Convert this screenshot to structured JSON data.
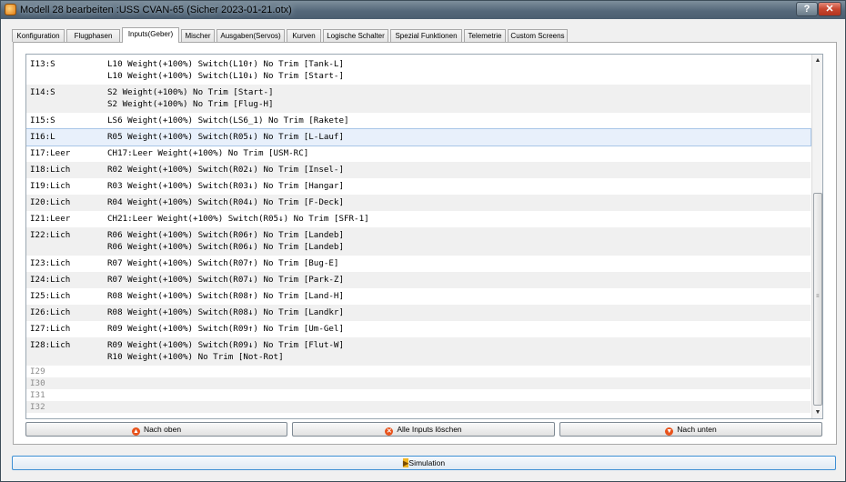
{
  "window": {
    "title": "Modell 28 bearbeiten :USS CVAN-65   (Sicher 2023-01-21.otx)",
    "help_label": "?",
    "close_label": "✕"
  },
  "tabs": [
    {
      "label": "Konfiguration"
    },
    {
      "label": "Flugphasen"
    },
    {
      "label": "Inputs(Geber)",
      "active": true
    },
    {
      "label": "Mischer"
    },
    {
      "label": "Ausgaben(Servos)"
    },
    {
      "label": "Kurven"
    },
    {
      "label": "Logische Schalter"
    },
    {
      "label": "Spezial Funktionen"
    },
    {
      "label": "Telemetrie"
    },
    {
      "label": "Custom Screens"
    }
  ],
  "inputs": [
    {
      "name": "I13:S",
      "lines": [
        "L10 Weight(+100%) Switch(L10↑) No Trim [Tank-L]",
        "L10 Weight(+100%) Switch(L10↓) No Trim [Start-]"
      ]
    },
    {
      "name": "I14:S",
      "lines": [
        "S2 Weight(+100%) No Trim [Start-]",
        "S2 Weight(+100%) No Trim [Flug-H]"
      ]
    },
    {
      "name": "I15:S",
      "lines": [
        "LS6 Weight(+100%) Switch(LS6_1) No Trim [Rakete]"
      ]
    },
    {
      "name": "I16:L",
      "lines": [
        "R05 Weight(+100%) Switch(R05↓) No Trim [L-Lauf]"
      ],
      "selected": true
    },
    {
      "name": "I17:Leer",
      "lines": [
        "CH17:Leer Weight(+100%) No Trim [USM-RC]"
      ]
    },
    {
      "name": "I18:Lich",
      "lines": [
        "R02 Weight(+100%) Switch(R02↓) No Trim [Insel-]"
      ]
    },
    {
      "name": "I19:Lich",
      "lines": [
        "R03 Weight(+100%) Switch(R03↓) No Trim [Hangar]"
      ]
    },
    {
      "name": "I20:Lich",
      "lines": [
        "R04 Weight(+100%) Switch(R04↓) No Trim [F-Deck]"
      ]
    },
    {
      "name": "I21:Leer",
      "lines": [
        "CH21:Leer Weight(+100%) Switch(R05↓) No Trim [SFR-1]"
      ]
    },
    {
      "name": "I22:Lich",
      "lines": [
        "R06 Weight(+100%) Switch(R06↑) No Trim [Landeb]",
        "R06 Weight(+100%) Switch(R06↓) No Trim [Landeb]"
      ]
    },
    {
      "name": "I23:Lich",
      "lines": [
        "R07 Weight(+100%) Switch(R07↑) No Trim [Bug-E]"
      ]
    },
    {
      "name": "I24:Lich",
      "lines": [
        "R07 Weight(+100%) Switch(R07↓) No Trim [Park-Z]"
      ]
    },
    {
      "name": "I25:Lich",
      "lines": [
        "R08 Weight(+100%) Switch(R08↑) No Trim [Land-H]"
      ]
    },
    {
      "name": "I26:Lich",
      "lines": [
        "R08 Weight(+100%) Switch(R08↓) No Trim [Landkr]"
      ]
    },
    {
      "name": "I27:Lich",
      "lines": [
        "R09 Weight(+100%) Switch(R09↑) No Trim [Um-Gel]"
      ]
    },
    {
      "name": "I28:Lich",
      "lines": [
        "R09 Weight(+100%) Switch(R09↓) No Trim [Flut-W]",
        "R10 Weight(+100%) No Trim [Not-Rot]"
      ]
    },
    {
      "name": "I29",
      "lines": [],
      "empty": true
    },
    {
      "name": "I30",
      "lines": [],
      "empty": true
    },
    {
      "name": "I31",
      "lines": [],
      "empty": true
    },
    {
      "name": "I32",
      "lines": [],
      "empty": true
    }
  ],
  "scrollbar": {
    "up_icon": "▲",
    "down_icon": "▼",
    "grip": "≡",
    "scroll_fraction": 1.0
  },
  "buttons": {
    "move_up": {
      "label": "Nach oben",
      "icon": "arrow-up-icon",
      "glyph": "▲"
    },
    "clear_all": {
      "label": "Alle Inputs löschen",
      "icon": "delete-icon",
      "glyph": "✕"
    },
    "move_down": {
      "label": "Nach unten",
      "icon": "arrow-down-icon",
      "glyph": "▼"
    },
    "simulation": {
      "label": "Simulation",
      "icon": "play-icon",
      "glyph": "▶"
    }
  },
  "colors": {
    "selection": "#e8f0fb",
    "accent": "#3c8fd4",
    "icon": "#e8531c"
  }
}
